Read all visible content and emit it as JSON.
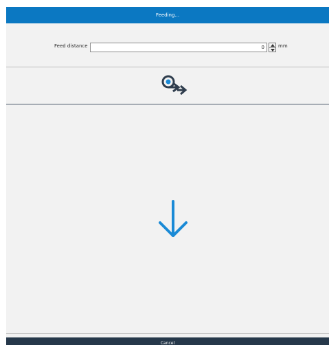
{
  "window": {
    "title": "Feeding..."
  },
  "feed": {
    "label": "Feed distance",
    "value": "0",
    "unit": "mm"
  },
  "icons": {
    "feed_roll": "roll-feed-arrow-icon",
    "direction": "arrow-down-icon",
    "spin_up": "chevron-up-icon",
    "spin_down": "chevron-down-icon"
  },
  "footer": {
    "cancel_label": "Cancel"
  },
  "colors": {
    "accent": "#0b78c2",
    "dark": "#26384a",
    "arrow": "#1a8ad6"
  }
}
